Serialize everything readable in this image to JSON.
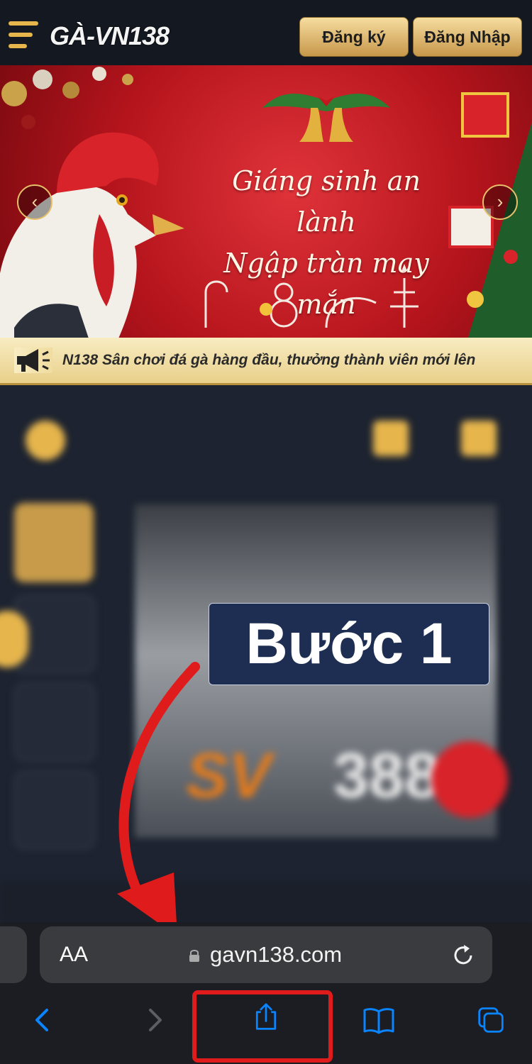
{
  "header": {
    "logo_text": "GÀ-VN138",
    "register_label": "Đăng ký",
    "login_label": "Đăng Nhập"
  },
  "banner": {
    "line1": "Giáng sinh an lành",
    "line2": "Ngập tràn may mắn",
    "prev_icon": "chevron-left-icon",
    "next_icon": "chevron-right-icon"
  },
  "ticker": {
    "text": "N138 Sân chơi đá gà hàng đầu, thưởng thành viên mới lên"
  },
  "overlay": {
    "step_label": "Bước 1"
  },
  "safari": {
    "text_size_label": "AA",
    "url": "gavn138.com"
  },
  "colors": {
    "gold": "#e6b54c",
    "banner_red": "#c4161d",
    "highlight_red": "#e01b1b",
    "step_bg": "#1e2d52",
    "ios_blue": "#0a84ff"
  }
}
